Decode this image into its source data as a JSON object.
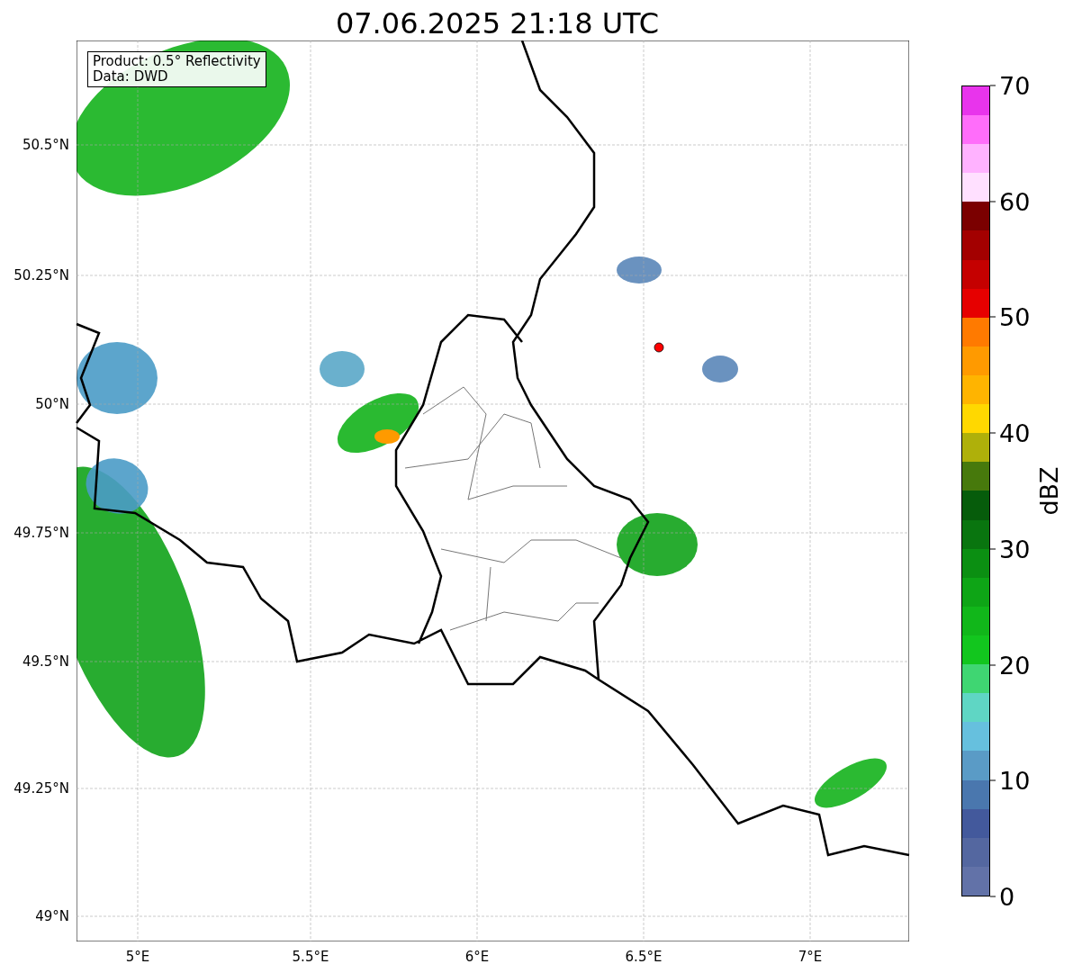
{
  "title": "07.06.2025 21:18 UTC",
  "info_box": {
    "lines": [
      "Product: 0.5° Reflectivity",
      "Data: DWD"
    ]
  },
  "map": {
    "y_ticks": [
      "50.5°N",
      "50.25°N",
      "50°N",
      "49.75°N",
      "49.5°N",
      "49.25°N",
      "49°N"
    ],
    "x_ticks": [
      "5°E",
      "5.5°E",
      "6°E",
      "6.5°E",
      "7°E"
    ]
  },
  "colorbar": {
    "label": "dBZ",
    "ticks": [
      "70",
      "60",
      "50",
      "40",
      "30",
      "20",
      "10",
      "0"
    ]
  }
}
